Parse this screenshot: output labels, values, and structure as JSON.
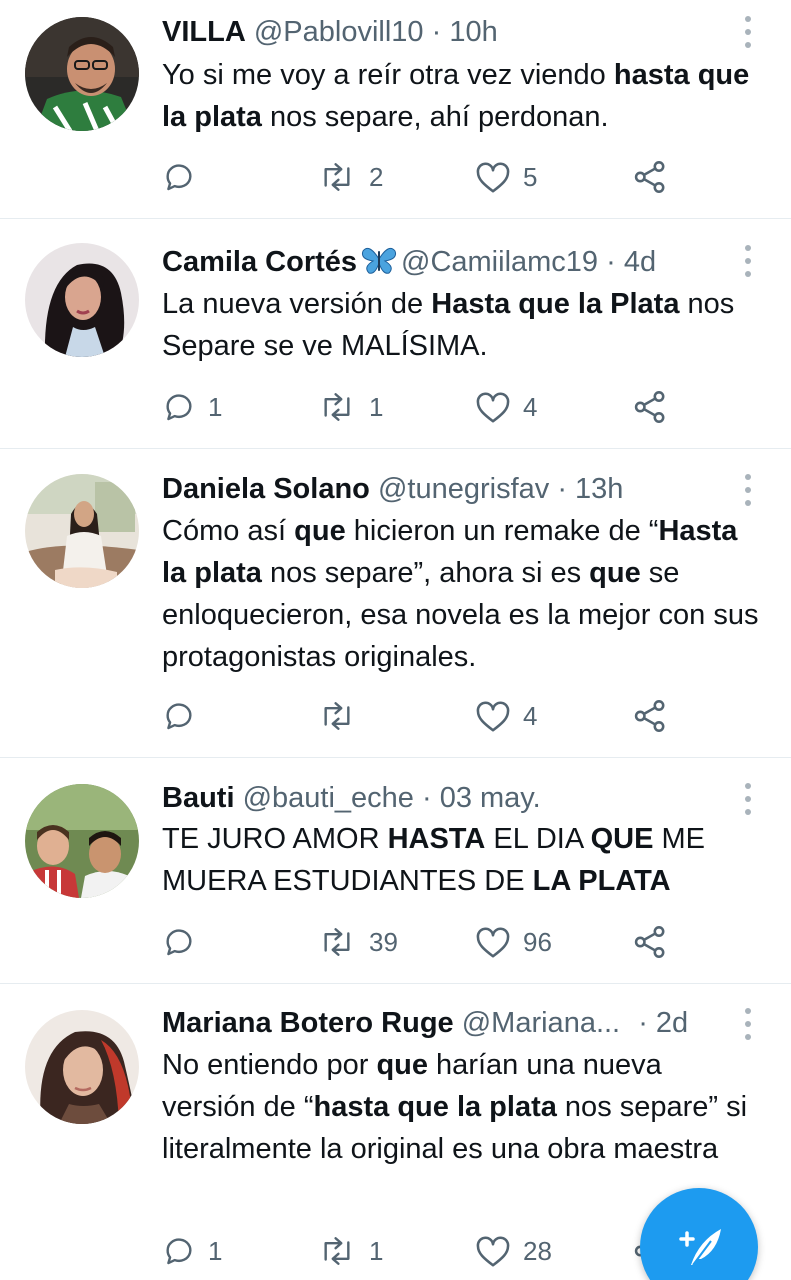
{
  "tweets": [
    {
      "name": "VILLA",
      "handle": "@Pablovill10",
      "time": "10h",
      "badge": "",
      "text_runs": [
        {
          "t": "Yo si me voy a reír otra vez viendo ",
          "b": false
        },
        {
          "t": "hasta que la plata",
          "b": true
        },
        {
          "t": " nos separe, ahí perdonan.",
          "b": false
        }
      ],
      "replies": "",
      "retweets": "2",
      "likes": "5"
    },
    {
      "name": "Camila Cortés",
      "handle": "@Camiilamc19",
      "time": "4d",
      "badge": "butterfly-emoji",
      "text_runs": [
        {
          "t": "La nueva versión de ",
          "b": false
        },
        {
          "t": "Hasta que la Plata",
          "b": true
        },
        {
          "t": " nos Separe se ve MALÍSIMA.",
          "b": false
        }
      ],
      "replies": "1",
      "retweets": "1",
      "likes": "4"
    },
    {
      "name": "Daniela Solano",
      "handle": "@tunegrisfav",
      "time": "13h",
      "badge": "",
      "text_runs": [
        {
          "t": "Cómo así ",
          "b": false
        },
        {
          "t": "que",
          "b": true
        },
        {
          "t": " hicieron un remake de “",
          "b": false
        },
        {
          "t": "Hasta la plata",
          "b": true
        },
        {
          "t": " nos separe”, ahora si es ",
          "b": false
        },
        {
          "t": "que",
          "b": true
        },
        {
          "t": " se enloquecieron, esa novela es la mejor con sus protagonistas originales.",
          "b": false
        }
      ],
      "replies": "",
      "retweets": "",
      "likes": "4"
    },
    {
      "name": "Bauti",
      "handle": "@bauti_eche",
      "time": "03 may.",
      "badge": "",
      "text_runs": [
        {
          "t": "TE JURO AMOR ",
          "b": false
        },
        {
          "t": "HASTA",
          "b": true
        },
        {
          "t": " EL DIA ",
          "b": false
        },
        {
          "t": "QUE",
          "b": true
        },
        {
          "t": " ME MUERA ESTUDIANTES DE ",
          "b": false
        },
        {
          "t": "LA PLATA",
          "b": true
        }
      ],
      "replies": "",
      "retweets": "39",
      "likes": "96"
    },
    {
      "name": "Mariana Botero Ruge",
      "handle": "@Mariana...",
      "time": "2d",
      "badge": "",
      "text_runs": [
        {
          "t": "No entiendo por ",
          "b": false
        },
        {
          "t": "que",
          "b": true
        },
        {
          "t": " harían una nueva versión de “",
          "b": false
        },
        {
          "t": "hasta que la plata",
          "b": true
        },
        {
          "t": " nos separe” si literalmente la original es una obra maestra",
          "b": false
        }
      ],
      "replies": "1",
      "retweets": "1",
      "likes": "28"
    }
  ],
  "compose_button": {
    "icon": "compose-feather-icon"
  },
  "colors": {
    "text": "#0f1419",
    "secondary": "#536471",
    "divider": "#e6ecf0",
    "accent": "#1d9bf0"
  }
}
